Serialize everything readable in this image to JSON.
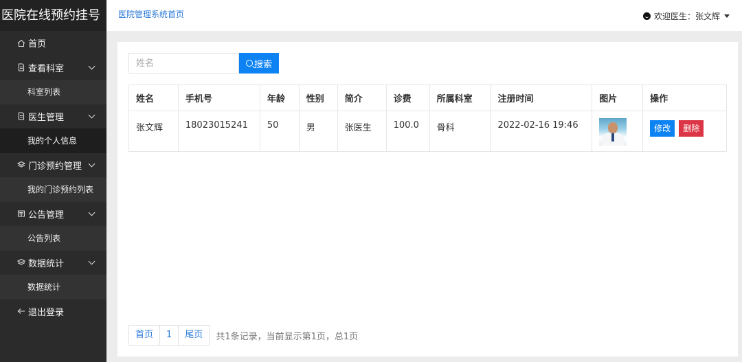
{
  "sidebar": {
    "brand": "医院在线预约挂号",
    "home": "首页",
    "groups": [
      {
        "label": "查看科室",
        "subs": [
          "科室列表"
        ]
      },
      {
        "label": "医生管理",
        "subs": [
          "我的个人信息"
        ]
      },
      {
        "label": "门诊预约管理",
        "subs": [
          "我的门诊预约列表"
        ]
      },
      {
        "label": "公告管理",
        "subs": [
          "公告列表"
        ]
      },
      {
        "label": "数据统计",
        "subs": [
          "数据统计"
        ]
      }
    ],
    "logout": "退出登录"
  },
  "header": {
    "breadcrumb": "医院管理系统首页",
    "user": "欢迎医生：张文辉"
  },
  "search": {
    "placeholder": "姓名",
    "button": "搜索"
  },
  "table": {
    "headers": [
      "姓名",
      "手机号",
      "年龄",
      "性别",
      "简介",
      "诊费",
      "所属科室",
      "注册时间",
      "图片",
      "操作"
    ],
    "rows": [
      {
        "name": "张文辉",
        "phone": "18023015241",
        "age": "50",
        "gender": "男",
        "intro": "张医生",
        "fee": "100.0",
        "dept": "骨科",
        "registered": "2022-02-16 19:46",
        "edit": "修改",
        "delete": "删除"
      }
    ]
  },
  "pagination": {
    "first": "首页",
    "page": "1",
    "last": "尾页",
    "info": "共1条记录，当前显示第1页，总1页"
  },
  "colors": {
    "accent": "#0d83f3",
    "danger": "#dc3545",
    "sidebar": "#2b2b2b"
  }
}
